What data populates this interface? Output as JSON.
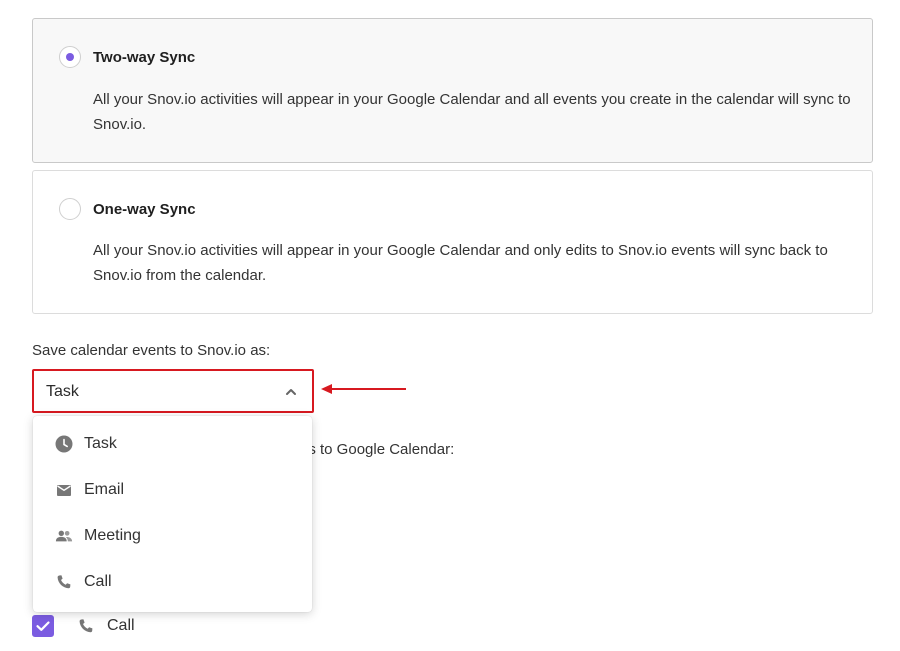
{
  "sync_options": [
    {
      "title": "Two-way Sync",
      "description": "All your Snov.io activities will appear in your Google Calendar and all events you create in the calendar will sync to Snov.io.",
      "selected": true
    },
    {
      "title": "One-way Sync",
      "description": "All your Snov.io activities will appear in your Google Calendar and only edits to Snov.io events will sync back to Snov.io from the calendar.",
      "selected": false
    }
  ],
  "save_as": {
    "label": "Save calendar events to Snov.io as:",
    "selected_value": "Task",
    "highlight_color": "#d71920",
    "chevron_icon": "chevron-up-icon",
    "options": [
      {
        "label": "Task",
        "icon": "clock-icon"
      },
      {
        "label": "Email",
        "icon": "envelope-icon"
      },
      {
        "label": "Meeting",
        "icon": "people-icon"
      },
      {
        "label": "Call",
        "icon": "phone-icon"
      }
    ]
  },
  "partial_label_behind_dropdown": "es to Google Calendar:",
  "activity_checkboxes": [
    {
      "label": "Call",
      "icon": "phone-icon",
      "checked": true
    }
  ],
  "colors": {
    "accent": "#7b5ce1",
    "annotation_red": "#d71920",
    "icon_gray": "#777777"
  }
}
